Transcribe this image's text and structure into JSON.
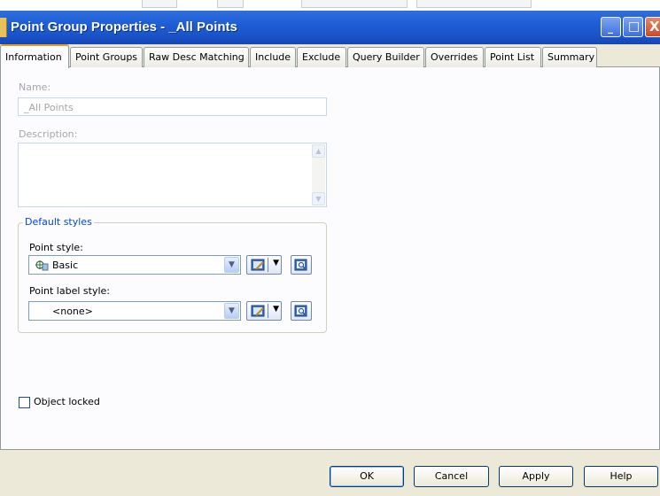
{
  "window": {
    "title": "Point Group Properties - _All Points",
    "controls": {
      "minimize": "_",
      "maximize": "□",
      "close": "X"
    }
  },
  "tabs": [
    {
      "label": "Information",
      "active": true
    },
    {
      "label": "Point Groups"
    },
    {
      "label": "Raw Desc Matching"
    },
    {
      "label": "Include"
    },
    {
      "label": "Exclude"
    },
    {
      "label": "Query Builder"
    },
    {
      "label": "Overrides"
    },
    {
      "label": "Point List"
    },
    {
      "label": "Summary"
    }
  ],
  "information": {
    "name_label": "Name:",
    "name_value": "_All Points",
    "description_label": "Description:",
    "description_value": "",
    "default_styles": {
      "legend": "Default styles",
      "point_style_label": "Point style:",
      "point_style_value": "Basic",
      "point_label_style_label": "Point label style:",
      "point_label_style_value": "<none>"
    },
    "object_locked_label": "Object locked",
    "object_locked": false
  },
  "buttons": {
    "ok": "OK",
    "cancel": "Cancel",
    "apply": "Apply",
    "help": "Help"
  },
  "colors": {
    "titlebar": "#1f5fd8",
    "dialog_bg": "#ece9d8",
    "panel_bg": "#fcfcfe",
    "active_tab_accent": "#e6a01f",
    "groupbox_legend": "#0046d5"
  }
}
